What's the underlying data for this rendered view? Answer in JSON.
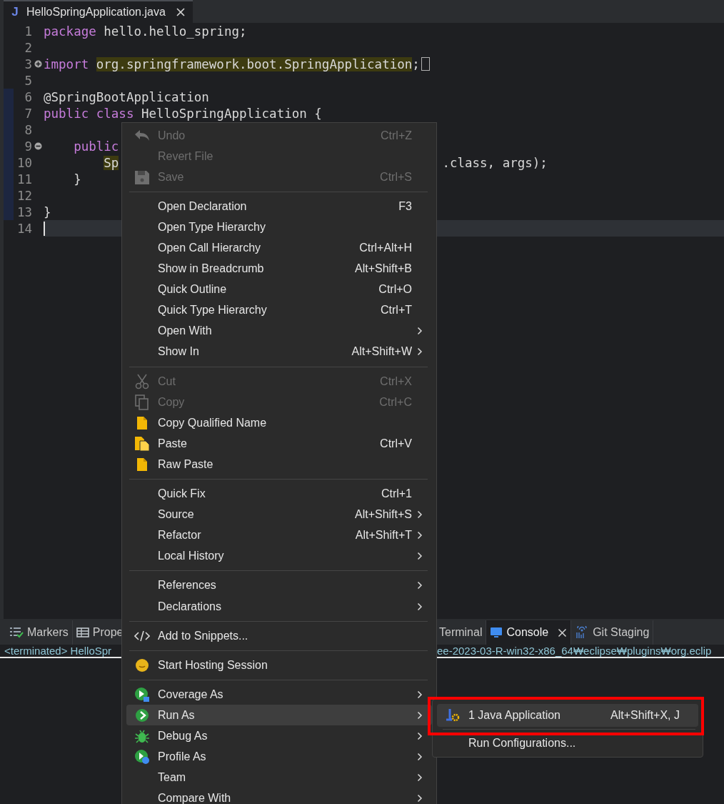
{
  "editor_tab": {
    "badge": "J",
    "title": "HelloSpringApplication.java",
    "selected": true
  },
  "code": [
    {
      "number": "1",
      "ruler": false,
      "current": false,
      "tokens": [
        {
          "kind": "keyword",
          "text": "package"
        },
        {
          "kind": "plain",
          "text": " hello.hello_spring;"
        }
      ]
    },
    {
      "number": "2",
      "ruler": false,
      "current": false
    },
    {
      "number": "3",
      "ruler": false,
      "current": false,
      "foldable": true,
      "expanded": false,
      "tokens": [
        {
          "kind": "keyword",
          "text": "import"
        },
        {
          "kind": "occurrence",
          "text": " org.springframework.boot.SpringApplication"
        },
        {
          "kind": "plain",
          "text": ";"
        },
        {
          "kind": "folded-marker"
        }
      ]
    },
    {
      "number": "5",
      "ruler": false,
      "current": false
    },
    {
      "number": "6",
      "ruler": true,
      "current": false,
      "tokens": [
        {
          "kind": "plain",
          "text": "@SpringBootApplication"
        }
      ]
    },
    {
      "number": "7",
      "ruler": true,
      "current": false,
      "tokens": [
        {
          "kind": "keyword",
          "text": "public"
        },
        {
          "kind": "keyword",
          "text": " class"
        },
        {
          "kind": "plain",
          "text": " HelloSpringApplication {"
        }
      ]
    },
    {
      "number": "8",
      "ruler": true,
      "current": false
    },
    {
      "number": "9",
      "ruler": true,
      "current": false,
      "foldable": true,
      "expanded": true,
      "tokens": [
        {
          "kind": "keyword",
          "text": "    public"
        }
      ]
    },
    {
      "number": "10",
      "ruler": true,
      "current": false,
      "tokens": [
        {
          "kind": "occurrence",
          "text": "        Sp"
        },
        {
          "kind": "covered"
        },
        {
          "kind": "plain",
          "text": ".class, args);"
        }
      ]
    },
    {
      "number": "11",
      "ruler": true,
      "current": false,
      "tokens": [
        {
          "kind": "plain",
          "text": "    }"
        }
      ]
    },
    {
      "number": "12",
      "ruler": true,
      "current": false
    },
    {
      "number": "13",
      "ruler": true,
      "current": false,
      "tokens": [
        {
          "kind": "plain",
          "text": "}"
        }
      ]
    },
    {
      "number": "14",
      "ruler": false,
      "current": true
    }
  ],
  "bottom_panel": {
    "left_tabs": [
      {
        "label": "Markers",
        "selected": false
      },
      {
        "label": "Prope",
        "selected": false
      }
    ],
    "right_tabs": [
      {
        "label": "Terminal",
        "selected": false
      },
      {
        "label": "Console",
        "selected": true,
        "closable": true
      },
      {
        "label": "Git Staging",
        "selected": false
      }
    ],
    "status_left": "<terminated> HelloSpr",
    "status_right": "ee-2023-03-R-win32-x86_64₩eclipse₩plugins₩org.eclip"
  },
  "context_menu": {
    "items": [
      {
        "kind": "item",
        "label": "Undo",
        "shortcut": "Ctrl+Z",
        "disabled": true,
        "submenu": false,
        "selected": false
      },
      {
        "kind": "item",
        "label": "Revert File",
        "disabled": true,
        "submenu": false,
        "selected": false
      },
      {
        "kind": "item",
        "label": "Save",
        "shortcut": "Ctrl+S",
        "disabled": true,
        "submenu": false,
        "selected": false
      },
      {
        "kind": "separator"
      },
      {
        "kind": "item",
        "label": "Open Declaration",
        "shortcut": "F3",
        "disabled": false,
        "submenu": false,
        "selected": false
      },
      {
        "kind": "item",
        "label": "Open Type Hierarchy",
        "disabled": false,
        "submenu": false,
        "selected": false
      },
      {
        "kind": "item",
        "label": "Open Call Hierarchy",
        "shortcut": "Ctrl+Alt+H",
        "disabled": false,
        "submenu": false,
        "selected": false
      },
      {
        "kind": "item",
        "label": "Show in Breadcrumb",
        "shortcut": "Alt+Shift+B",
        "disabled": false,
        "submenu": false,
        "selected": false
      },
      {
        "kind": "item",
        "label": "Quick Outline",
        "shortcut": "Ctrl+O",
        "disabled": false,
        "submenu": false,
        "selected": false
      },
      {
        "kind": "item",
        "label": "Quick Type Hierarchy",
        "shortcut": "Ctrl+T",
        "disabled": false,
        "submenu": false,
        "selected": false
      },
      {
        "kind": "item",
        "label": "Open With",
        "disabled": false,
        "submenu": true,
        "selected": false
      },
      {
        "kind": "item",
        "label": "Show In",
        "shortcut": "Alt+Shift+W",
        "disabled": false,
        "submenu": true,
        "selected": false
      },
      {
        "kind": "separator"
      },
      {
        "kind": "item",
        "label": "Cut",
        "shortcut": "Ctrl+X",
        "disabled": true,
        "submenu": false,
        "selected": false
      },
      {
        "kind": "item",
        "label": "Copy",
        "shortcut": "Ctrl+C",
        "disabled": true,
        "submenu": false,
        "selected": false
      },
      {
        "kind": "item",
        "label": "Copy Qualified Name",
        "disabled": false,
        "submenu": false,
        "selected": false
      },
      {
        "kind": "item",
        "label": "Paste",
        "shortcut": "Ctrl+V",
        "disabled": false,
        "submenu": false,
        "selected": false
      },
      {
        "kind": "item",
        "label": "Raw Paste",
        "disabled": false,
        "submenu": false,
        "selected": false
      },
      {
        "kind": "separator"
      },
      {
        "kind": "item",
        "label": "Quick Fix",
        "shortcut": "Ctrl+1",
        "disabled": false,
        "submenu": false,
        "selected": false
      },
      {
        "kind": "item",
        "label": "Source",
        "shortcut": "Alt+Shift+S",
        "disabled": false,
        "submenu": true,
        "selected": false
      },
      {
        "kind": "item",
        "label": "Refactor",
        "shortcut": "Alt+Shift+T",
        "disabled": false,
        "submenu": true,
        "selected": false
      },
      {
        "kind": "item",
        "label": "Local History",
        "disabled": false,
        "submenu": true,
        "selected": false
      },
      {
        "kind": "separator"
      },
      {
        "kind": "item",
        "label": "References",
        "disabled": false,
        "submenu": true,
        "selected": false
      },
      {
        "kind": "item",
        "label": "Declarations",
        "disabled": false,
        "submenu": true,
        "selected": false
      },
      {
        "kind": "separator"
      },
      {
        "kind": "item",
        "label": "Add to Snippets...",
        "disabled": false,
        "submenu": false,
        "selected": false
      },
      {
        "kind": "separator"
      },
      {
        "kind": "item",
        "label": "Start Hosting Session",
        "disabled": false,
        "submenu": false,
        "selected": false
      },
      {
        "kind": "separator"
      },
      {
        "kind": "item",
        "label": "Coverage As",
        "disabled": false,
        "submenu": true,
        "selected": false
      },
      {
        "kind": "item",
        "label": "Run As",
        "disabled": false,
        "submenu": true,
        "selected": true
      },
      {
        "kind": "item",
        "label": "Debug As",
        "disabled": false,
        "submenu": true,
        "selected": false
      },
      {
        "kind": "item",
        "label": "Profile As",
        "disabled": false,
        "submenu": true,
        "selected": false
      },
      {
        "kind": "item",
        "label": "Team",
        "disabled": false,
        "submenu": true,
        "selected": false
      },
      {
        "kind": "item",
        "label": "Compare With",
        "disabled": false,
        "submenu": true,
        "selected": false
      }
    ]
  },
  "submenu": {
    "items": [
      {
        "kind": "item",
        "label": "1 Java Application",
        "shortcut": "Alt+Shift+X, J",
        "selected": true,
        "annotated": true
      },
      {
        "kind": "separator"
      },
      {
        "kind": "item",
        "label": "Run Configurations...",
        "selected": false,
        "annotated": false
      }
    ]
  }
}
